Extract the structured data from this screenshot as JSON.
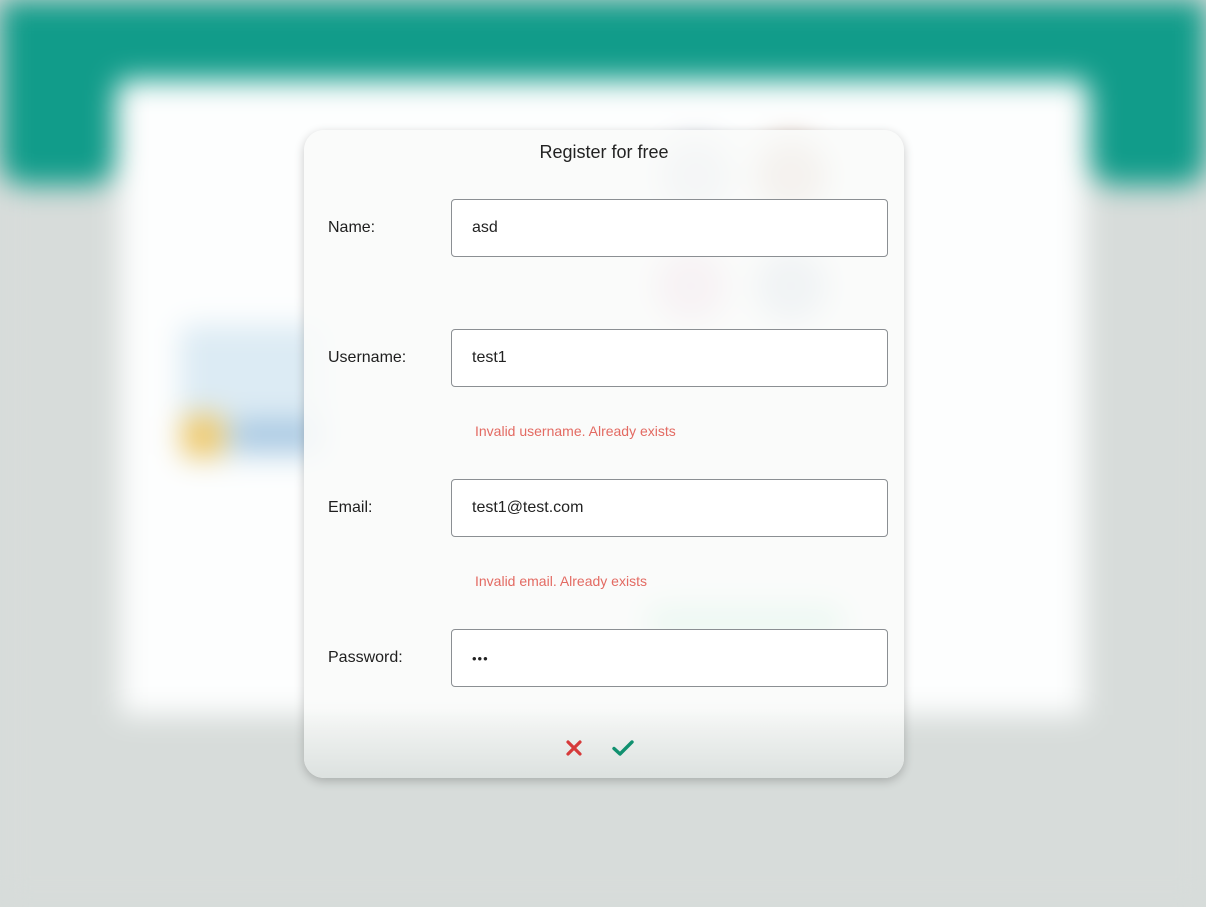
{
  "dialog": {
    "title": "Register for free",
    "fields": {
      "name": {
        "label": "Name:",
        "value": "asd"
      },
      "username": {
        "label": "Username:",
        "value": "test1",
        "error": "Invalid username. Already exists"
      },
      "email": {
        "label": "Email:",
        "value": "test1@test.com",
        "error": "Invalid email. Already exists"
      },
      "password": {
        "label": "Password:",
        "value": "•••"
      }
    },
    "actions": {
      "cancel_icon": "close-icon",
      "confirm_icon": "check-icon"
    }
  },
  "colors": {
    "brand": "#119c8a",
    "error_text": "#e36a62",
    "cancel": "#d63a3a",
    "confirm": "#119170"
  }
}
